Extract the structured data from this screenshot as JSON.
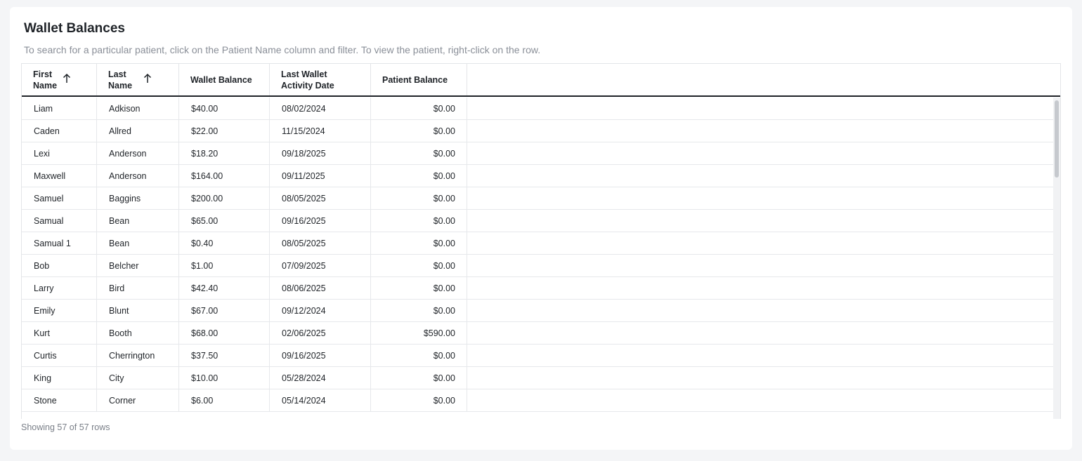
{
  "panel": {
    "title": "Wallet Balances",
    "subtitle": "To search for a particular patient, click on the Patient Name column and filter. To view the patient, right-click on the row."
  },
  "table": {
    "columns": [
      {
        "label": "First Name",
        "sort": "ascending",
        "sort_icon": "arrow-up-icon"
      },
      {
        "label": "Last Name",
        "sort": "ascending",
        "sort_icon": "arrow-up-icon"
      },
      {
        "label": "Wallet Balance"
      },
      {
        "label": "Last Wallet Activity Date"
      },
      {
        "label": "Patient Balance"
      }
    ],
    "rows": [
      [
        "Liam",
        "Adkison",
        "$40.00",
        "08/02/2024",
        "$0.00"
      ],
      [
        "Caden",
        "Allred",
        "$22.00",
        "11/15/2024",
        "$0.00"
      ],
      [
        "Lexi",
        "Anderson",
        "$18.20",
        "09/18/2025",
        "$0.00"
      ],
      [
        "Maxwell",
        "Anderson",
        "$164.00",
        "09/11/2025",
        "$0.00"
      ],
      [
        "Samuel",
        "Baggins",
        "$200.00",
        "08/05/2025",
        "$0.00"
      ],
      [
        "Samual",
        "Bean",
        "$65.00",
        "09/16/2025",
        "$0.00"
      ],
      [
        "Samual 1",
        "Bean",
        "$0.40",
        "08/05/2025",
        "$0.00"
      ],
      [
        "Bob",
        "Belcher",
        "$1.00",
        "07/09/2025",
        "$0.00"
      ],
      [
        "Larry",
        "Bird",
        "$42.40",
        "08/06/2025",
        "$0.00"
      ],
      [
        "Emily",
        "Blunt",
        "$67.00",
        "09/12/2024",
        "$0.00"
      ],
      [
        "Kurt",
        "Booth",
        "$68.00",
        "02/06/2025",
        "$590.00"
      ],
      [
        "Curtis",
        "Cherrington",
        "$37.50",
        "09/16/2025",
        "$0.00"
      ],
      [
        "King",
        "City",
        "$10.00",
        "05/28/2024",
        "$0.00"
      ],
      [
        "Stone",
        "Corner",
        "$6.00",
        "05/14/2024",
        "$0.00"
      ]
    ]
  },
  "footer": {
    "row_count_text": "Showing 57 of 57 rows"
  },
  "colors": {
    "header_rule": "#1f2328",
    "grid_line": "#e6e8eb",
    "muted_text": "#8a8f98"
  }
}
